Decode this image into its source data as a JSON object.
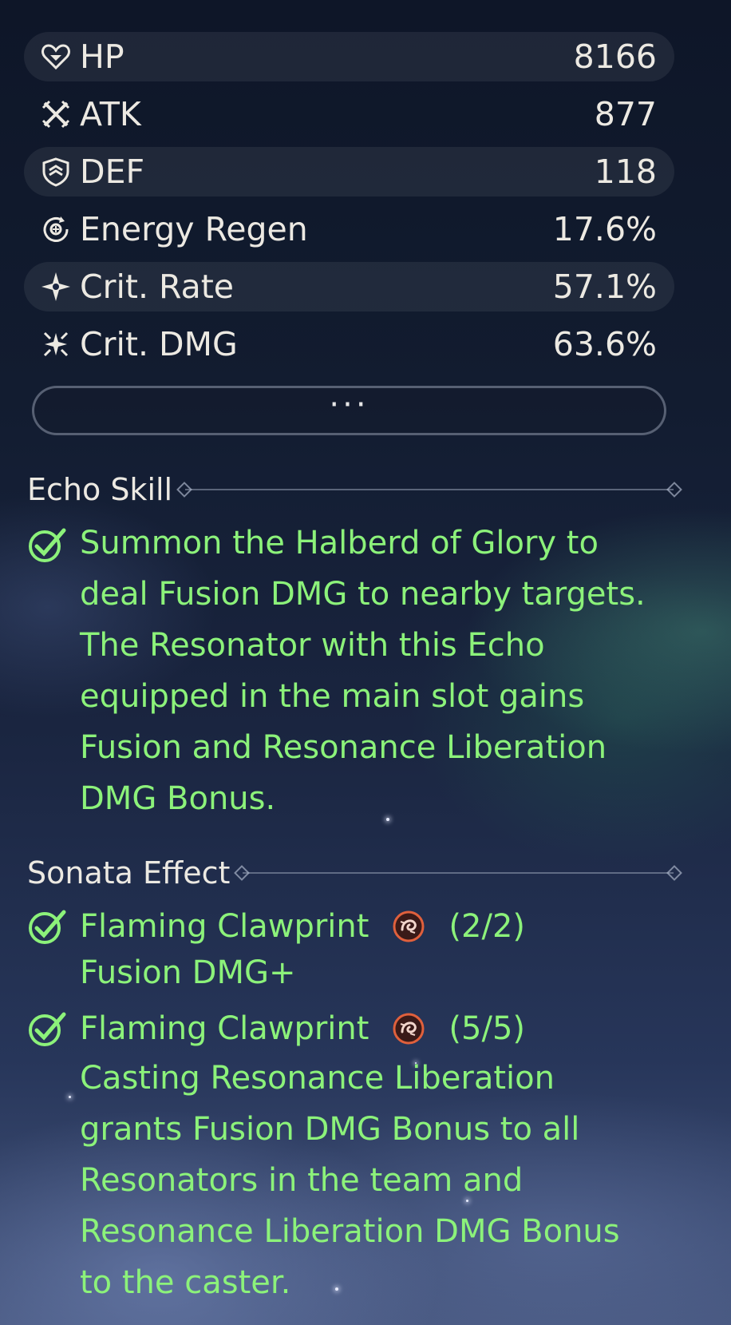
{
  "stats": [
    {
      "name": "HP",
      "value": "8166",
      "icon": "heart-icon"
    },
    {
      "name": "ATK",
      "value": "877",
      "icon": "crossed-swords-icon"
    },
    {
      "name": "DEF",
      "value": "118",
      "icon": "shield-icon"
    },
    {
      "name": "Energy Regen",
      "value": "17.6%",
      "icon": "energy-regen-icon"
    },
    {
      "name": "Crit. Rate",
      "value": "57.1%",
      "icon": "crit-rate-icon"
    },
    {
      "name": "Crit. DMG",
      "value": "63.6%",
      "icon": "crit-dmg-icon"
    }
  ],
  "more_button": {
    "label": "···"
  },
  "echo_skill": {
    "title": "Echo Skill",
    "lines": [
      "Summon the Halberd of Glory to",
      "deal Fusion DMG to nearby targets.",
      "The Resonator with this Echo",
      "equipped in the main slot gains",
      "Fusion and Resonance Liberation",
      "DMG Bonus."
    ]
  },
  "sonata_effect": {
    "title": "Sonata Effect",
    "items": [
      {
        "name": "Flaming Clawprint",
        "count": "(2/2)",
        "description": [
          "Fusion DMG+"
        ],
        "icon": "fusion-element-icon"
      },
      {
        "name": "Flaming Clawprint",
        "count": "(5/5)",
        "description": [
          "Casting Resonance Liberation",
          "grants Fusion DMG Bonus to all",
          "Resonators in the team and",
          "Resonance Liberation DMG Bonus",
          "to the caster."
        ],
        "icon": "fusion-element-icon"
      }
    ]
  },
  "colors": {
    "text": "#ece9e2",
    "active_green": "#8cf27a",
    "fusion_orange": "#e0603c"
  }
}
